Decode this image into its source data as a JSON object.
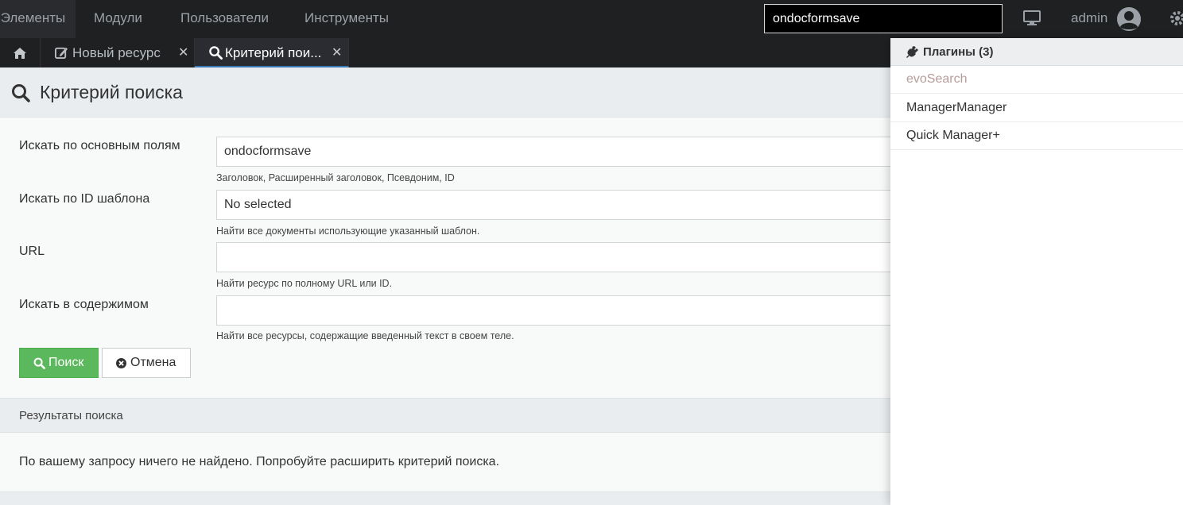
{
  "topnav": {
    "items": [
      "Элементы",
      "Модули",
      "Пользователи",
      "Инструменты"
    ],
    "search_value": "ondocformsave",
    "user": "admin"
  },
  "tabs": [
    {
      "label": "Новый ресурс",
      "close": "✕"
    },
    {
      "label": "Критерий пои...",
      "close": "✕"
    }
  ],
  "page": {
    "title": "Критерий поиска"
  },
  "form": {
    "fields": [
      {
        "label": "Искать по основным полям",
        "value": "ondocformsave",
        "help": "Заголовок, Расширенный заголовок, Псевдоним, ID"
      },
      {
        "label": "Искать по ID шаблона",
        "value": "No selected",
        "help": "Найти все документы использующие указанный шаблон."
      },
      {
        "label": "URL",
        "value": "",
        "help": "Найти ресурс по полному URL или ID."
      },
      {
        "label": "Искать в содержимом",
        "value": "",
        "help": "Найти все ресурсы, содержащие введенный текст в своем теле."
      }
    ],
    "search_button": "Поиск",
    "cancel_button": "Отмена"
  },
  "results": {
    "title": "Результаты поиска",
    "message": "По вашему запросу ничего не найдено. Попробуйте расширить критерий поиска."
  },
  "dropdown": {
    "title": "Плагины (3)",
    "items": [
      "evoSearch",
      "ManagerManager",
      "Quick Manager+"
    ]
  },
  "colors": {
    "topbar": "#1f2022",
    "success": "#5cb85c",
    "active_tab_border": "#3a7ab8"
  }
}
